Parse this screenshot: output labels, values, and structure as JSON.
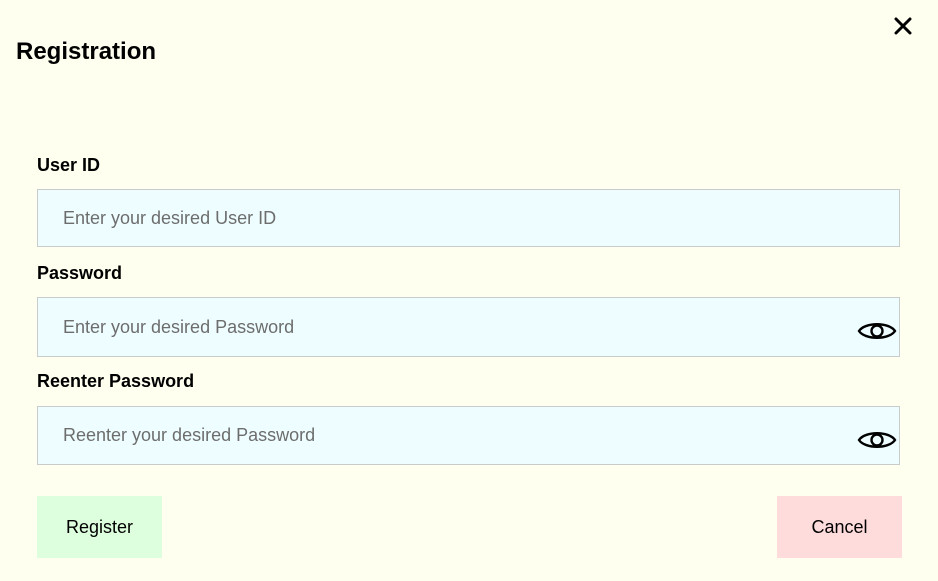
{
  "dialog": {
    "title": "Registration",
    "close_icon": "close-icon"
  },
  "fields": {
    "user_id": {
      "label": "User ID",
      "value": "",
      "placeholder": "Enter your desired User ID"
    },
    "password": {
      "label": "Password",
      "value": "",
      "placeholder": "Enter your desired Password",
      "toggle_icon": "eye-icon"
    },
    "reenter_password": {
      "label": "Reenter Password",
      "value": "",
      "placeholder": "Reenter your desired Password",
      "toggle_icon": "eye-icon"
    }
  },
  "buttons": {
    "register_label": "Register",
    "cancel_label": "Cancel"
  },
  "colors": {
    "background": "#fffff0",
    "field_background": "#eefdff",
    "field_border": "#c9cccc",
    "register_button": "#ddffdd",
    "cancel_button": "#ffdcdc",
    "placeholder_text": "#6d6d6d"
  }
}
